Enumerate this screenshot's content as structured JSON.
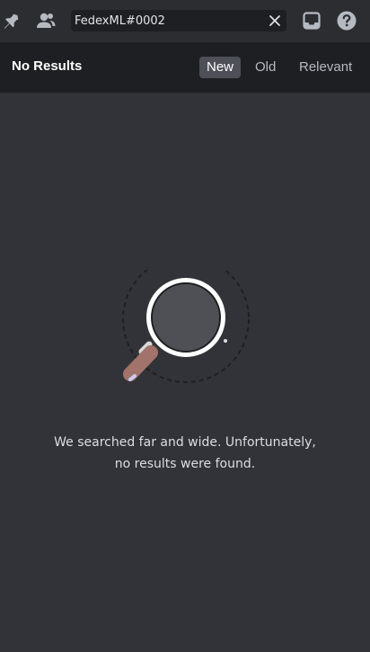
{
  "toolbar": {
    "icons": [
      "pin-icon",
      "members-icon",
      "inbox-icon",
      "help-icon"
    ],
    "search": {
      "value": "FedexML#0002",
      "clear_icon": "close-icon"
    }
  },
  "results_header": {
    "title": "No Results",
    "sort_tabs": [
      {
        "label": "New",
        "active": true
      },
      {
        "label": "Old",
        "active": false
      },
      {
        "label": "Relevant",
        "active": false
      }
    ]
  },
  "empty_state": {
    "illustration": "magnifying-glass-icon",
    "message_line1": "We searched far and wide. Unfortunately,",
    "message_line2": "no results were found."
  },
  "colors": {
    "background": "#313338",
    "toolbar": "#2b2d31",
    "header": "#1e1f22",
    "active_tab": "#4e5058",
    "handle": "#a1736b"
  }
}
